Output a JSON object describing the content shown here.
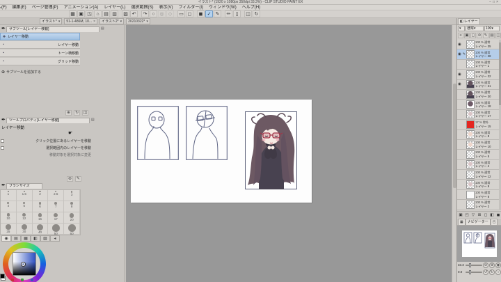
{
  "window": {
    "title": "イラスト* (1920 x 1080px 350dpi 33.3%) - CLIP STUDIO PAINT EX",
    "controls": [
      "−",
      "□",
      "×"
    ]
  },
  "menu": {
    "items": [
      "ファイル(F)",
      "編集(E)",
      "ページ管理(P)",
      "アニメーション(A)",
      "レイヤー(L)",
      "選択範囲(S)",
      "表示(V)",
      "フィルター(I)",
      "ウィンドウ(W)",
      "ヘルプ(H)"
    ]
  },
  "toolbar": {
    "icons": [
      {
        "name": "workspace-icon",
        "glyph": "▦",
        "sep": true
      },
      {
        "name": "new-file-icon",
        "glyph": "▣"
      },
      {
        "name": "open-file-icon",
        "glyph": "◳"
      },
      {
        "name": "save-icon",
        "glyph": "⌂"
      },
      {
        "name": "print-icon",
        "glyph": "▤"
      },
      {
        "name": "print-preview-icon",
        "glyph": "▥"
      },
      {
        "name": "export-icon",
        "glyph": "▨",
        "sep": true
      },
      {
        "name": "undo-icon",
        "glyph": "↶"
      },
      {
        "name": "redo-icon",
        "glyph": "↷",
        "sep": true
      },
      {
        "name": "deselect-icon",
        "glyph": "○"
      },
      {
        "name": "reselect-icon",
        "glyph": "◎",
        "disabled": true
      },
      {
        "name": "invert-selection-icon",
        "glyph": "◇",
        "disabled": true
      },
      {
        "name": "selection-border-icon",
        "glyph": "▭",
        "sep": true
      },
      {
        "name": "clear-icon",
        "glyph": "◻"
      },
      {
        "name": "fill-icon",
        "glyph": "◼",
        "sep": true
      },
      {
        "name": "snap-ruler-icon",
        "glyph": "✓",
        "active": true
      },
      {
        "name": "snap-special-ruler-icon",
        "glyph": "✎"
      },
      {
        "name": "snap-grid-icon",
        "glyph": "✏",
        "sep": true
      },
      {
        "name": "ruler-icon",
        "glyph": "▯"
      },
      {
        "name": "companion-device-icon",
        "glyph": "◫",
        "sep": true
      },
      {
        "name": "rotate-reset-icon",
        "glyph": "↻"
      }
    ]
  },
  "doc_tabs": [
    {
      "label": "イラスト*",
      "dropdown": true
    },
    {
      "label": "51-1-486M, 10...",
      "close": true
    },
    {
      "label": "イラスト2*",
      "dropdown": true
    },
    {
      "label": "20210322*",
      "dropdown": true
    }
  ],
  "subtool": {
    "title": "サブツール[レイヤー移動]",
    "items": [
      {
        "label": "レイヤー移動",
        "selected": true
      },
      {
        "label": "レイヤー移動"
      },
      {
        "label": "トーン柄移動"
      },
      {
        "label": "グリッド移動"
      }
    ],
    "add_label": "サブツールを追加する",
    "footer_icons": [
      {
        "name": "add-subtool-icon",
        "glyph": "⊕"
      },
      {
        "name": "copy-subtool-icon",
        "glyph": "↻"
      },
      {
        "name": "delete-subtool-icon",
        "glyph": "◫"
      }
    ]
  },
  "toolprop": {
    "title": "ツールプロパティ[レイヤー移動]",
    "tool_name": "レイヤー移動",
    "options": [
      {
        "label": "クリック位置にあるレイヤーを移動",
        "checkbox": true,
        "checked": false
      },
      {
        "label": "選択範囲内のレイヤーを移動",
        "checkbox": true,
        "checked": false
      },
      {
        "label": "移動対象を選択対象に変更",
        "checkbox": false
      }
    ],
    "footer_icons": [
      {
        "name": "toolprop-detail-icon",
        "glyph": "⊛"
      },
      {
        "name": "toolprop-reset-icon",
        "glyph": "✎"
      }
    ]
  },
  "brush": {
    "title": "ブラシサイズ",
    "sizes": [
      [
        "1",
        "1.5",
        "2",
        "2.5",
        "3"
      ],
      [
        "4",
        "5",
        "6",
        "7",
        "8"
      ],
      [
        "10",
        "12",
        "15",
        "17",
        "20"
      ],
      [
        "25",
        "30",
        "40",
        "50",
        "60"
      ]
    ]
  },
  "color": {
    "selected_hex": "#1e2b52",
    "main_swatch": "#000000",
    "sub_swatch": "#ffffff",
    "tabs": [
      {
        "name": "color-wheel-tab",
        "glyph": "◉",
        "active": true
      },
      {
        "name": "color-set-tab",
        "glyph": "▤"
      },
      {
        "name": "color-slider-tab",
        "glyph": "▦"
      },
      {
        "name": "color-mixer-tab",
        "glyph": "◧"
      },
      {
        "name": "approx-color-tab",
        "glyph": "▨"
      },
      {
        "name": "color-history-tab",
        "glyph": "◂"
      }
    ]
  },
  "layer_palette": {
    "tab": "レイヤー",
    "blend_mode": "通常",
    "opacity": "100",
    "tool_icons": [
      {
        "name": "lock-transparent-icon",
        "glyph": "≡"
      },
      {
        "name": "lock-layer-icon",
        "glyph": "▣"
      },
      {
        "name": "clip-to-layer-icon",
        "glyph": "◻"
      },
      {
        "name": "reference-layer-icon",
        "glyph": "⊘"
      },
      {
        "name": "draft-layer-icon",
        "glyph": "✎"
      },
      {
        "name": "mask-enable-icon",
        "glyph": "▤"
      },
      {
        "name": "ruler-show-icon",
        "glyph": "◫"
      }
    ],
    "rows": [
      {
        "eye": true,
        "sel": false,
        "thumb": "checker",
        "mode": "100 % 通常",
        "name": "レイヤー 35"
      },
      {
        "eye": true,
        "sel": true,
        "thumb": "checker",
        "mode": "100 % 通常",
        "name": "レイヤー 28"
      },
      {
        "eye": false,
        "sel": false,
        "thumb": "checker",
        "mode": "100 % 通常",
        "name": "レイヤー 1"
      },
      {
        "eye": true,
        "sel": false,
        "thumb": "checker",
        "mode": "100 % 通常",
        "name": "レイヤー 22"
      },
      {
        "eye": true,
        "sel": false,
        "thumb": "artdark",
        "mode": "100 % 通常",
        "name": "レイヤー 21"
      },
      {
        "eye": false,
        "sel": false,
        "thumb": "artdark",
        "mode": "100 % 通常",
        "name": "レイヤー 30"
      },
      {
        "eye": false,
        "sel": false,
        "thumb": "artgirl",
        "mode": "100 % 通常",
        "name": "レイヤー 18"
      },
      {
        "eye": false,
        "sel": false,
        "thumb": "artlight",
        "mode": "100 % 通常",
        "name": "レイヤー 17"
      },
      {
        "eye": false,
        "sel": false,
        "thumb": "red",
        "mode": "17 % 除外",
        "name": "レイヤー 15"
      },
      {
        "eye": false,
        "sel": false,
        "thumb": "face",
        "mode": "100 % 通常",
        "name": "レイヤー 8"
      },
      {
        "eye": false,
        "sel": false,
        "thumb": "face",
        "mode": "100 % 通常",
        "name": "レイヤー 10"
      },
      {
        "eye": false,
        "sel": false,
        "thumb": "checker",
        "mode": "100 % 通常",
        "name": "レイヤー 5"
      },
      {
        "eye": false,
        "sel": false,
        "thumb": "artlight",
        "mode": "100 % 通常",
        "name": "レイヤー 4"
      },
      {
        "eye": false,
        "sel": false,
        "thumb": "checker",
        "mode": "100 % 通常",
        "name": "レイヤー 12"
      },
      {
        "eye": false,
        "sel": false,
        "thumb": "artlight",
        "mode": "100 % 通常",
        "name": "レイヤー 9"
      },
      {
        "eye": false,
        "sel": false,
        "thumb": "white",
        "mode": "100 % 通常",
        "name": "レイヤー 6"
      },
      {
        "eye": false,
        "sel": false,
        "thumb": "checker",
        "mode": "100 % 通常",
        "name": "レイヤー 2"
      }
    ],
    "footer_icons": [
      {
        "name": "new-layer-icon",
        "glyph": "▣"
      },
      {
        "name": "new-folder-icon",
        "glyph": "◰"
      },
      {
        "name": "transfer-layer-icon",
        "glyph": "▽"
      },
      {
        "name": "merge-layer-icon",
        "glyph": "⊞"
      },
      {
        "name": "layer-mask-icon",
        "glyph": "◻"
      },
      {
        "name": "apply-mask-icon",
        "glyph": "◧"
      },
      {
        "name": "delete-layer-icon",
        "glyph": "◼"
      }
    ]
  },
  "navigator": {
    "tab": "ナビゲーター",
    "zoom_value": "33.3",
    "rotate_value": "0.0",
    "zoom_buttons": [
      {
        "name": "zoom-out-button",
        "glyph": "⊖"
      },
      {
        "name": "zoom-in-button",
        "glyph": "⊕"
      },
      {
        "name": "zoom-fit-button",
        "glyph": "◉"
      }
    ],
    "rotate_buttons": [
      {
        "name": "rotate-left-button",
        "glyph": "↺"
      },
      {
        "name": "rotate-right-button",
        "glyph": "↻"
      },
      {
        "name": "rotate-reset-button",
        "glyph": "○"
      }
    ]
  }
}
